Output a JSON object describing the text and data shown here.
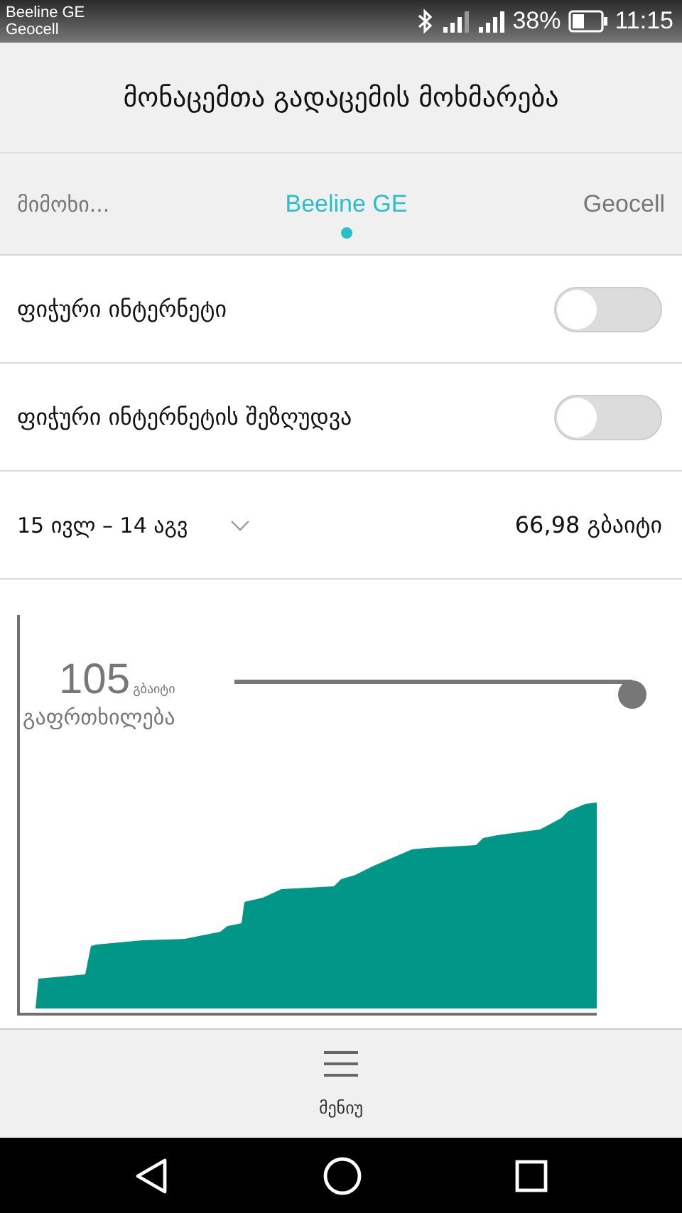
{
  "status_bar": {
    "carriers": [
      "Beeline GE",
      "Geocell"
    ],
    "battery": "38%",
    "time": "11:15"
  },
  "title": "მონაცემთა გადაცემის მოხმარება",
  "tabs": [
    {
      "label": "მიმოხი...",
      "selected": false
    },
    {
      "label": "Beeline GE",
      "selected": true
    },
    {
      "label": "Geocell",
      "selected": false
    }
  ],
  "toggles": [
    {
      "label": "ფიჭური ინტერნეტი",
      "on": false
    },
    {
      "label": "ფიჭური ინტერნეტის შეზღუდვა",
      "on": false
    }
  ],
  "period": {
    "range": "15 ივლ – 14 აგვ",
    "usage": "66,98 გბაიტი"
  },
  "warning": {
    "value": "105",
    "unit": "გბაიტი",
    "label": "გაფრთხილება"
  },
  "bottom_bar": {
    "menu_label": "მენიუ"
  }
}
